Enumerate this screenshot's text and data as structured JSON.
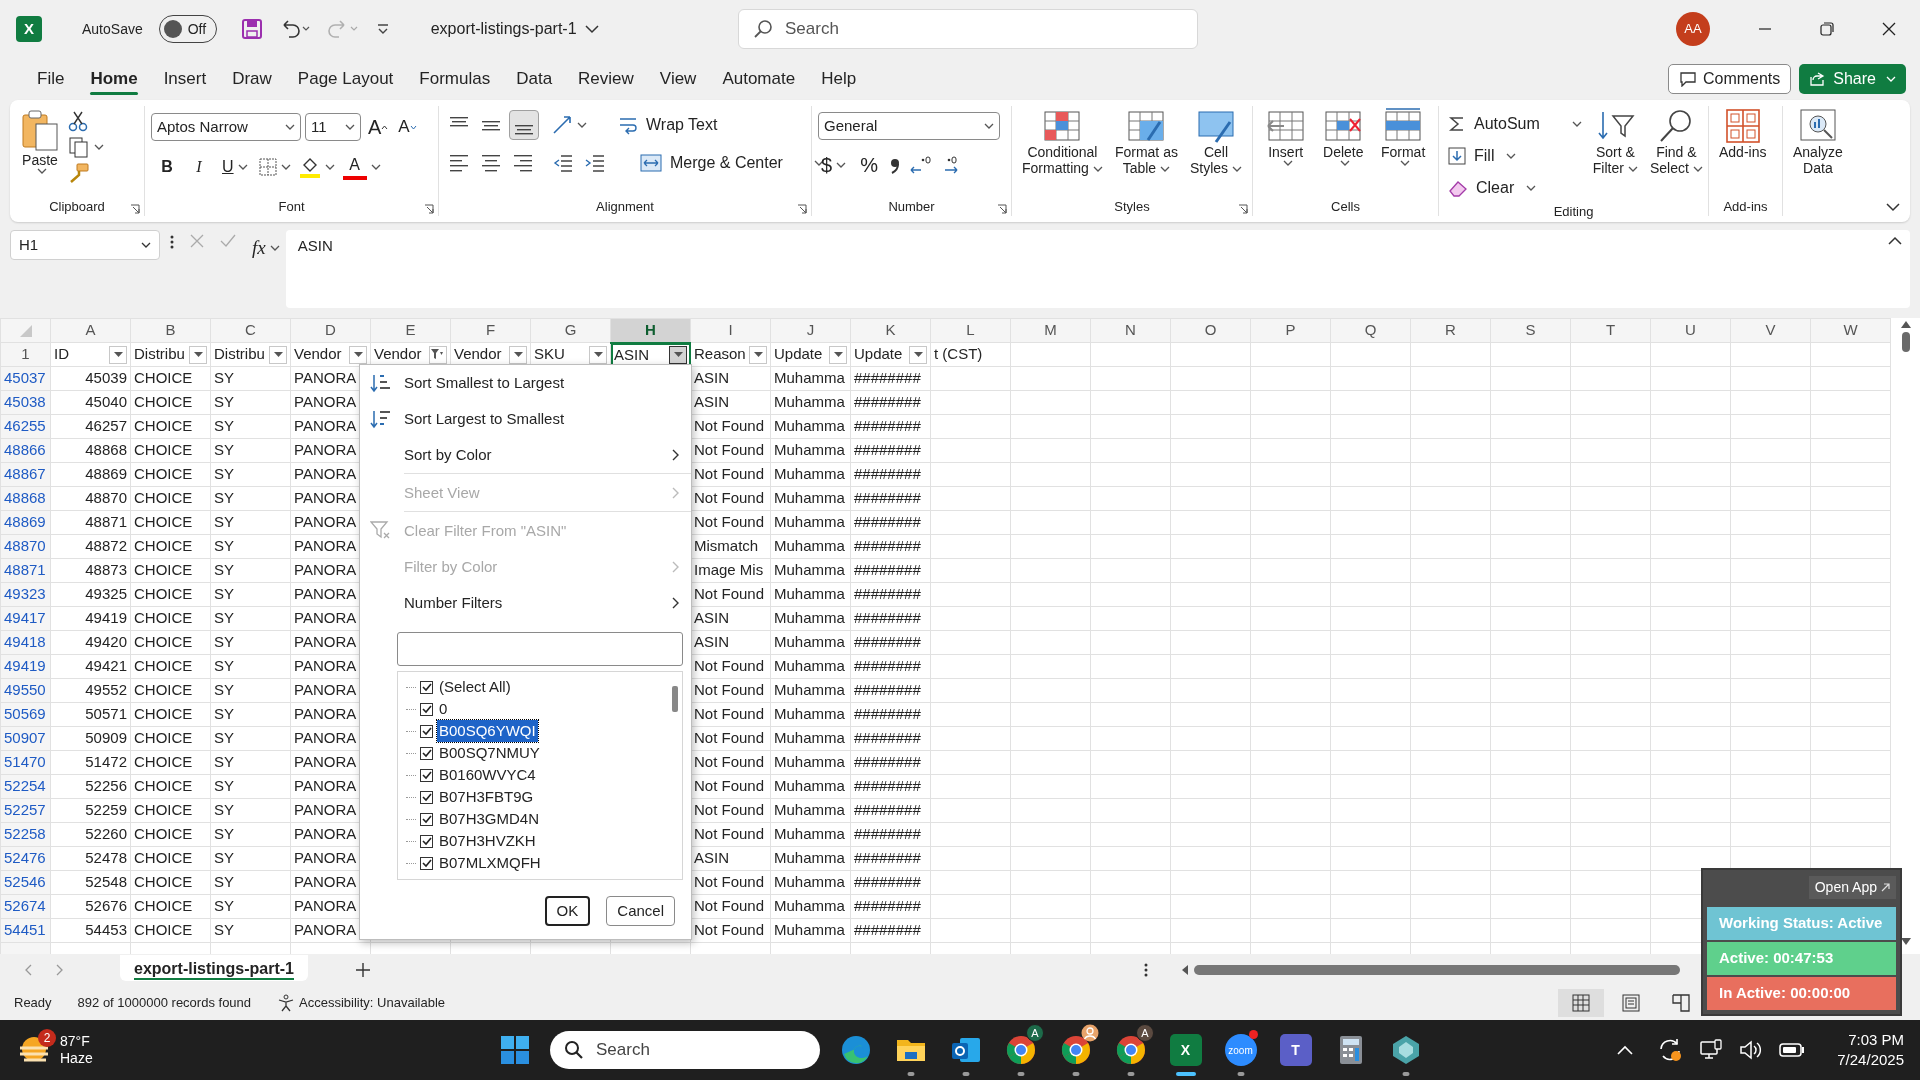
{
  "title_bar": {
    "logo": "X",
    "autosave_label": "AutoSave",
    "autosave": {
      "on": false,
      "text": "Off"
    },
    "redo": {
      "disabled": true
    },
    "file_name": "export-listings-part-1",
    "search": {
      "placeholder": "Search"
    },
    "avatar": "AA"
  },
  "ribbon_tabs": [
    {
      "label": "File",
      "selected": false
    },
    {
      "label": "Home",
      "selected": true
    },
    {
      "label": "Insert",
      "selected": false
    },
    {
      "label": "Draw",
      "selected": false
    },
    {
      "label": "Page Layout",
      "selected": false
    },
    {
      "label": "Formulas",
      "selected": false
    },
    {
      "label": "Data",
      "selected": false
    },
    {
      "label": "Review",
      "selected": false
    },
    {
      "label": "View",
      "selected": false
    },
    {
      "label": "Automate",
      "selected": false
    },
    {
      "label": "Help",
      "selected": false
    }
  ],
  "comments_button": "Comments",
  "share_button": "Share",
  "ribbon": {
    "clipboard": {
      "paste": "Paste",
      "group": "Clipboard"
    },
    "font": {
      "name": "Aptos Narrow",
      "size": "11",
      "grow": "A",
      "shrink": "A",
      "bold": "B",
      "italic": "I",
      "underline": "U",
      "font_color": "A",
      "group": "Font"
    },
    "alignment": {
      "vertical": [
        {
          "selected": false
        },
        {
          "selected": false
        },
        {
          "selected": true
        }
      ],
      "wrap": "Wrap Text",
      "merge": "Merge & Center",
      "group": "Alignment"
    },
    "number": {
      "format": "General",
      "currency": "$",
      "percent": "%",
      "group": "Number"
    },
    "styles": {
      "buttons": [
        [
          "Conditional",
          "Formatting"
        ],
        [
          "Format as",
          "Table"
        ],
        [
          "Cell",
          "Styles"
        ]
      ],
      "group": "Styles"
    },
    "cells": {
      "buttons": [
        [
          "Insert"
        ],
        [
          "Delete"
        ],
        [
          "Format"
        ]
      ],
      "group": "Cells"
    },
    "editing": {
      "small": [
        "AutoSum",
        "Fill",
        "Clear"
      ],
      "buttons": [
        [
          "Sort &",
          "Filter"
        ],
        [
          "Find &",
          "Select"
        ]
      ],
      "group": "Editing"
    },
    "addins": {
      "buttons": [
        [
          "Add-ins"
        ]
      ],
      "group": "Add-ins"
    },
    "analyze": {
      "buttons": [
        [
          "Analyze",
          "Data"
        ]
      ]
    }
  },
  "formula_bar": {
    "name_box": "H1",
    "fx": "fx",
    "content": "ASIN"
  },
  "columns": [
    {
      "letter": "A",
      "selected": false
    },
    {
      "letter": "B",
      "selected": false
    },
    {
      "letter": "C",
      "selected": false
    },
    {
      "letter": "D",
      "selected": false
    },
    {
      "letter": "E",
      "selected": false
    },
    {
      "letter": "F",
      "selected": false
    },
    {
      "letter": "G",
      "selected": false
    },
    {
      "letter": "H",
      "selected": true
    },
    {
      "letter": "I",
      "selected": false
    },
    {
      "letter": "J",
      "selected": false
    },
    {
      "letter": "K",
      "selected": false
    },
    {
      "letter": "L",
      "selected": false
    },
    {
      "letter": "M",
      "selected": false
    },
    {
      "letter": "N",
      "selected": false
    },
    {
      "letter": "O",
      "selected": false
    },
    {
      "letter": "P",
      "selected": false
    },
    {
      "letter": "Q",
      "selected": false
    },
    {
      "letter": "R",
      "selected": false
    },
    {
      "letter": "S",
      "selected": false
    },
    {
      "letter": "T",
      "selected": false
    },
    {
      "letter": "U",
      "selected": false
    },
    {
      "letter": "V",
      "selected": false
    },
    {
      "letter": "W",
      "selected": false
    }
  ],
  "header_row": {
    "number": "1",
    "cells": [
      {
        "text": "ID",
        "filter_button": true,
        "filtered": false,
        "open": false,
        "selected": false
      },
      {
        "text": "Distribu",
        "filter_button": true,
        "filtered": false,
        "open": false,
        "selected": false
      },
      {
        "text": "Distribu",
        "filter_button": true,
        "filtered": false,
        "open": false,
        "selected": false
      },
      {
        "text": "Vendor",
        "filter_button": true,
        "filtered": false,
        "open": false,
        "selected": false
      },
      {
        "text": "Vendor",
        "filter_button": true,
        "filtered": true,
        "open": false,
        "selected": false
      },
      {
        "text": "Vendor",
        "filter_button": true,
        "filtered": false,
        "open": false,
        "selected": false
      },
      {
        "text": "SKU",
        "filter_button": true,
        "filtered": false,
        "open": false,
        "selected": false
      },
      {
        "text": "ASIN",
        "filter_button": true,
        "filtered": false,
        "open": true,
        "selected": true
      },
      {
        "text": "Reason",
        "filter_button": true,
        "filtered": false,
        "open": false,
        "selected": false
      },
      {
        "text": "Update",
        "filter_button": true,
        "filtered": false,
        "open": false,
        "selected": false
      },
      {
        "text": "Update",
        "filter_button": true,
        "filtered": false,
        "open": false,
        "selected": false
      },
      {
        "text": "t (CST)",
        "filter_button": false,
        "filtered": false,
        "open": false,
        "selected": false
      }
    ]
  },
  "rows": [
    {
      "row": "45037",
      "A": "45039",
      "B": "CHOICE",
      "C": "SY",
      "D": "PANORA",
      "I": "ASIN",
      "J": "Muhamma",
      "K": "########"
    },
    {
      "row": "45038",
      "A": "45040",
      "B": "CHOICE",
      "C": "SY",
      "D": "PANORA",
      "I": "ASIN",
      "J": "Muhamma",
      "K": "########"
    },
    {
      "row": "46255",
      "A": "46257",
      "B": "CHOICE",
      "C": "SY",
      "D": "PANORA",
      "I": "Not Found",
      "J": "Muhamma",
      "K": "########"
    },
    {
      "row": "48866",
      "A": "48868",
      "B": "CHOICE",
      "C": "SY",
      "D": "PANORA",
      "I": "Not Found",
      "J": "Muhamma",
      "K": "########"
    },
    {
      "row": "48867",
      "A": "48869",
      "B": "CHOICE",
      "C": "SY",
      "D": "PANORA",
      "I": "Not Found",
      "J": "Muhamma",
      "K": "########"
    },
    {
      "row": "48868",
      "A": "48870",
      "B": "CHOICE",
      "C": "SY",
      "D": "PANORA",
      "I": "Not Found",
      "J": "Muhamma",
      "K": "########"
    },
    {
      "row": "48869",
      "A": "48871",
      "B": "CHOICE",
      "C": "SY",
      "D": "PANORA",
      "I": "Not Found",
      "J": "Muhamma",
      "K": "########"
    },
    {
      "row": "48870",
      "A": "48872",
      "B": "CHOICE",
      "C": "SY",
      "D": "PANORA",
      "I": "Mismatch",
      "J": "Muhamma",
      "K": "########"
    },
    {
      "row": "48871",
      "A": "48873",
      "B": "CHOICE",
      "C": "SY",
      "D": "PANORA",
      "I": "Image Mis",
      "J": "Muhamma",
      "K": "########"
    },
    {
      "row": "49323",
      "A": "49325",
      "B": "CHOICE",
      "C": "SY",
      "D": "PANORA",
      "I": "Not Found",
      "J": "Muhamma",
      "K": "########"
    },
    {
      "row": "49417",
      "A": "49419",
      "B": "CHOICE",
      "C": "SY",
      "D": "PANORA",
      "I": "ASIN",
      "J": "Muhamma",
      "K": "########"
    },
    {
      "row": "49418",
      "A": "49420",
      "B": "CHOICE",
      "C": "SY",
      "D": "PANORA",
      "I": "ASIN",
      "J": "Muhamma",
      "K": "########"
    },
    {
      "row": "49419",
      "A": "49421",
      "B": "CHOICE",
      "C": "SY",
      "D": "PANORA",
      "I": "Not Found",
      "J": "Muhamma",
      "K": "########"
    },
    {
      "row": "49550",
      "A": "49552",
      "B": "CHOICE",
      "C": "SY",
      "D": "PANORA",
      "I": "Not Found",
      "J": "Muhamma",
      "K": "########"
    },
    {
      "row": "50569",
      "A": "50571",
      "B": "CHOICE",
      "C": "SY",
      "D": "PANORA",
      "I": "Not Found",
      "J": "Muhamma",
      "K": "########"
    },
    {
      "row": "50907",
      "A": "50909",
      "B": "CHOICE",
      "C": "SY",
      "D": "PANORA",
      "I": "Not Found",
      "J": "Muhamma",
      "K": "########"
    },
    {
      "row": "51470",
      "A": "51472",
      "B": "CHOICE",
      "C": "SY",
      "D": "PANORA",
      "I": "Not Found",
      "J": "Muhamma",
      "K": "########"
    },
    {
      "row": "52254",
      "A": "52256",
      "B": "CHOICE",
      "C": "SY",
      "D": "PANORA",
      "I": "Not Found",
      "J": "Muhamma",
      "K": "########"
    },
    {
      "row": "52257",
      "A": "52259",
      "B": "CHOICE",
      "C": "SY",
      "D": "PANORA",
      "I": "Not Found",
      "J": "Muhamma",
      "K": "########"
    },
    {
      "row": "52258",
      "A": "52260",
      "B": "CHOICE",
      "C": "SY",
      "D": "PANORA",
      "I": "Not Found",
      "J": "Muhamma",
      "K": "########"
    },
    {
      "row": "52476",
      "A": "52478",
      "B": "CHOICE",
      "C": "SY",
      "D": "PANORA",
      "I": "ASIN",
      "J": "Muhamma",
      "K": "########"
    },
    {
      "row": "52546",
      "A": "52548",
      "B": "CHOICE",
      "C": "SY",
      "D": "PANORA",
      "I": "Not Found",
      "J": "Muhamma",
      "K": "########"
    },
    {
      "row": "52674",
      "A": "52676",
      "B": "CHOICE",
      "C": "SY",
      "D": "PANORA",
      "I": "Not Found",
      "J": "Muhamma",
      "K": "########"
    },
    {
      "row": "54451",
      "A": "54453",
      "B": "CHOICE",
      "C": "SY",
      "D": "PANORA",
      "I": "Not Found",
      "J": "Muhamma",
      "K": "########"
    }
  ],
  "filter_menu": {
    "groups": [
      [
        {
          "label": "Sort Smallest to Largest",
          "kind": "sort_asc",
          "disabled": false
        },
        {
          "label": "Sort Largest to Smallest",
          "kind": "sort_desc",
          "disabled": false
        },
        {
          "label": "Sort by Color",
          "kind": "submenu",
          "disabled": false
        }
      ],
      [
        {
          "label": "Sheet View",
          "kind": "submenu",
          "disabled": true
        }
      ],
      [
        {
          "label": "Clear Filter From \"ASIN\"",
          "kind": "clear",
          "disabled": true
        },
        {
          "label": "Filter by Color",
          "kind": "submenu",
          "disabled": true
        },
        {
          "label": "Number Filters",
          "kind": "submenu",
          "disabled": false
        }
      ]
    ],
    "values": [
      {
        "label": "(Select All)",
        "checked": true,
        "selected": false
      },
      {
        "label": "0",
        "checked": true,
        "selected": false
      },
      {
        "label": "B00SQ6YWQI",
        "checked": true,
        "selected": true
      },
      {
        "label": "B00SQ7NMUY",
        "checked": true,
        "selected": false
      },
      {
        "label": "B0160WVYC4",
        "checked": true,
        "selected": false
      },
      {
        "label": "B07H3FBT9G",
        "checked": true,
        "selected": false
      },
      {
        "label": "B07H3GMD4N",
        "checked": true,
        "selected": false
      },
      {
        "label": "B07H3HVZKH",
        "checked": true,
        "selected": false
      },
      {
        "label": "B07MLXMQFH",
        "checked": true,
        "selected": false
      }
    ],
    "ok": "OK",
    "cancel": "Cancel"
  },
  "sheet_tabs": [
    {
      "label": "export-listings-part-1",
      "selected": true
    }
  ],
  "status_bar": {
    "mode": "Ready",
    "records": "892 of 1000000 records found",
    "accessibility": "Accessibility: Unavailable",
    "views": [
      {
        "kind": "normal",
        "selected": true
      },
      {
        "kind": "page_layout",
        "selected": false
      },
      {
        "kind": "page_break",
        "selected": false
      }
    ]
  },
  "tracker": {
    "open_app": "Open App",
    "statuses": [
      {
        "text": "Working Status: Active",
        "color": "#6fc4d3"
      },
      {
        "text": "Active: 00:47:53",
        "color": "#5fd08c"
      },
      {
        "text": "In Active: 00:00:00",
        "color": "#e86f5e"
      }
    ]
  },
  "taskbar": {
    "weather": {
      "badge": "2",
      "temp": "87°F",
      "condition": "Haze"
    },
    "search": {
      "placeholder": "Search"
    },
    "apps": [
      {
        "kind": "edge",
        "running": false,
        "active": false
      },
      {
        "kind": "files",
        "running": true,
        "active": false
      },
      {
        "kind": "outlook",
        "running": true,
        "active": false
      },
      {
        "kind": "chrome",
        "running": true,
        "active": false,
        "profile": {
          "kind": "letter",
          "text": "A",
          "color": "#1d6b4a"
        }
      },
      {
        "kind": "chrome",
        "running": true,
        "active": false,
        "profile": {
          "kind": "avatar"
        }
      },
      {
        "kind": "chrome",
        "running": true,
        "active": false,
        "profile": {
          "kind": "letter",
          "text": "A",
          "color": "#5b4a40"
        }
      },
      {
        "kind": "excel",
        "running": true,
        "active": true,
        "glyph": "X"
      },
      {
        "kind": "zoom",
        "running": true,
        "active": false,
        "glyph": "zoom"
      },
      {
        "kind": "teams",
        "running": false,
        "active": false,
        "glyph": "T"
      },
      {
        "kind": "calculator",
        "running": false,
        "active": false
      },
      {
        "kind": "diamond",
        "running": true,
        "active": false
      }
    ],
    "time": "7:03 PM",
    "date": "7/24/2025"
  }
}
